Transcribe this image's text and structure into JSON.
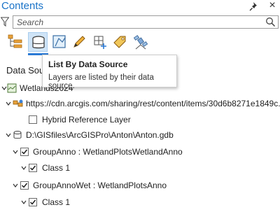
{
  "pane": {
    "title": "Contents",
    "close_glyph": "×"
  },
  "search": {
    "placeholder": "Search"
  },
  "toolbar": {
    "buttons": [
      {
        "icon": "list-by-drawing-order-icon"
      },
      {
        "icon": "list-by-data-source-icon",
        "selected": true
      },
      {
        "icon": "list-by-selection-icon"
      },
      {
        "icon": "list-by-editing-icon"
      },
      {
        "icon": "list-by-snapping-icon"
      },
      {
        "icon": "list-by-labeling-icon"
      },
      {
        "icon": "list-by-perspective-imagery-icon"
      }
    ]
  },
  "tooltip": {
    "title": "List By Data Source",
    "description": "Layers are listed by their data source."
  },
  "section": {
    "label": "Data Sou"
  },
  "tree": {
    "map_name": "Wetlands2024",
    "service_url": "https://cdn.arcgis.com/sharing/rest/content/items/30d6b8271e1849c...",
    "hybrid_layer": "Hybrid Reference Layer",
    "gdb_path": "D:\\GISfiles\\ArcGISPro\\Anton\\Anton.gdb",
    "group1": "GroupAnno : WetlandPlotsWetlandAnno",
    "group1_class": "Class 1",
    "group2": "GroupAnnoWet : WetlandPlotsAnno",
    "group2_class": "Class 1"
  },
  "colors": {
    "accent": "#1a73c8",
    "selected_tab": "#cfe4f7",
    "tab_underline": "#2a7ad5"
  }
}
